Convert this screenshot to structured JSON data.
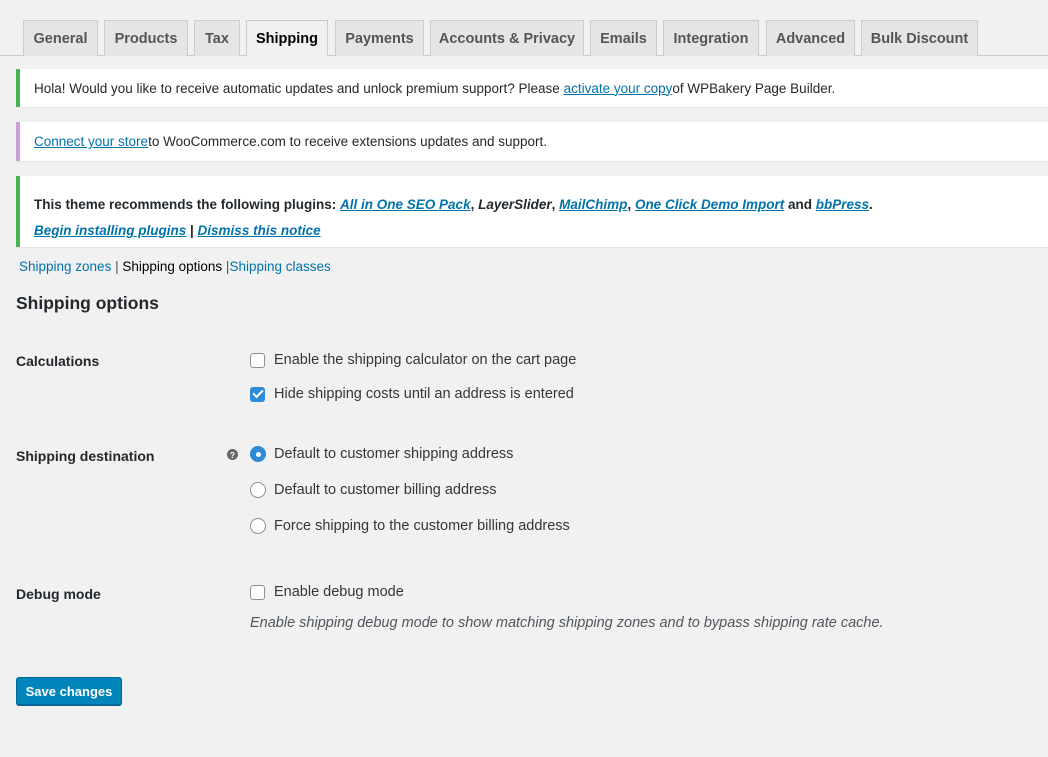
{
  "tabs": [
    "General",
    "Products",
    "Tax",
    "Shipping",
    "Payments",
    "Accounts & Privacy",
    "Emails",
    "Integration",
    "Advanced",
    "Bulk Discount"
  ],
  "active_tab": "Shipping",
  "notices": {
    "wpbakery": {
      "before": "Hola! Would you like to receive automatic updates and unlock premium support? Please ",
      "link": "activate your copy",
      "after": " of WPBakery Page Builder."
    },
    "woocommerce": {
      "link": "Connect your store",
      "after": " to WooCommerce.com to receive extensions updates and support."
    },
    "plugins": {
      "intro": "This theme recommends the following plugins: ",
      "p1": "All in One SEO Pack",
      "sep1": ", ",
      "p2": "LayerSlider",
      "sep2": ", ",
      "p3": "MailChimp",
      "sep3": ", ",
      "p4": "One Click Demo Import",
      "and": " and ",
      "p5": "bbPress",
      "end": ".",
      "begin": "Begin installing plugins",
      "bar": " | ",
      "dismiss": "Dismiss this notice"
    }
  },
  "subnav": {
    "zones": "Shipping zones",
    "sep1": " | ",
    "options": "Shipping options",
    "sep2": " |",
    "classes": "Shipping classes"
  },
  "heading": "Shipping options",
  "calculations": {
    "label": "Calculations",
    "opt1": "Enable the shipping calculator on the cart page",
    "opt2": "Hide shipping costs until an address is entered"
  },
  "destination": {
    "label": "Shipping destination",
    "help": "?",
    "opt1": "Default to customer shipping address",
    "opt2": "Default to customer billing address",
    "opt3": "Force shipping to the customer billing address"
  },
  "debug": {
    "label": "Debug mode",
    "opt": "Enable debug mode",
    "desc": "Enable shipping debug mode to show matching shipping zones and to bypass shipping rate cache."
  },
  "save_label": "Save changes",
  "colors": {
    "accent": "#0073aa",
    "button": "#0085ba",
    "notice_green": "#46b450",
    "notice_purple": "#c9a0d6"
  }
}
